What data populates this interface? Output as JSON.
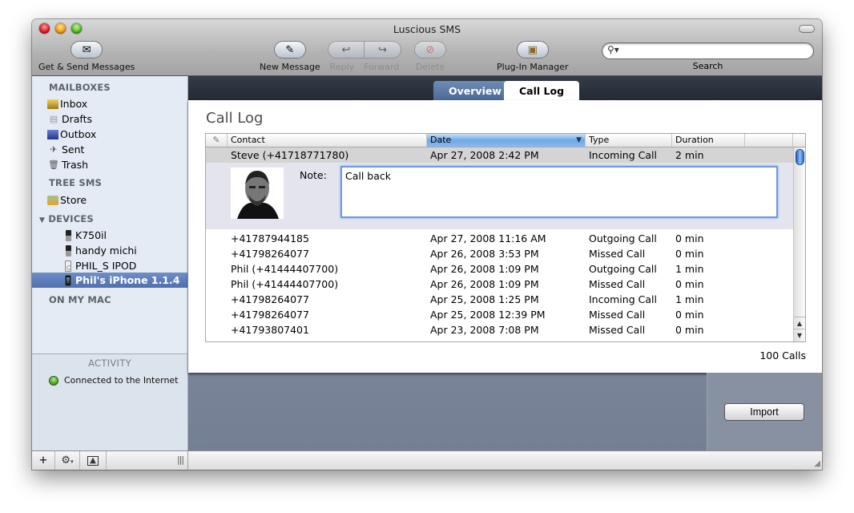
{
  "window": {
    "title": "Luscious SMS"
  },
  "toolbar": {
    "get_send": "Get & Send Messages",
    "new_message": "New Message",
    "reply": "Reply",
    "forward": "Forward",
    "delete": "Delete",
    "plugin_manager": "Plug-In Manager",
    "search_label": "Search",
    "search_placeholder": ""
  },
  "sidebar": {
    "mailboxes_header": "MAILBOXES",
    "mailboxes": [
      {
        "label": "Inbox",
        "icon": "inbox-icon"
      },
      {
        "label": "Drafts",
        "icon": "drafts-icon"
      },
      {
        "label": "Outbox",
        "icon": "outbox-icon"
      },
      {
        "label": "Sent",
        "icon": "sent-icon"
      },
      {
        "label": "Trash",
        "icon": "trash-icon"
      }
    ],
    "tree_header": "TREE SMS",
    "store": "Store",
    "devices_header": "DEVICES",
    "devices": [
      {
        "label": "K750il",
        "icon": "phone-icon"
      },
      {
        "label": "handy michi",
        "icon": "phone-icon"
      },
      {
        "label": "PHIL_S IPOD",
        "icon": "ipod-icon"
      },
      {
        "label": "Phil's iPhone 1.1.4",
        "icon": "iphone-icon",
        "selected": true
      }
    ],
    "on_my_mac_header": "ON MY MAC",
    "activity_title": "ACTIVITY",
    "activity_status": "Connected to the Internet",
    "activity_color": "#3ba416"
  },
  "tabs": {
    "overview": "Overview",
    "call_log": "Call Log",
    "active": "Call Log"
  },
  "panel": {
    "title": "Call Log",
    "columns": {
      "edit": "✎",
      "contact": "Contact",
      "date": "Date",
      "type": "Type",
      "duration": "Duration"
    },
    "selected_row": {
      "contact": "Steve (+41718771780)",
      "date": "Apr 27, 2008 2:42 PM",
      "type": "Incoming Call",
      "duration": "2 min"
    },
    "note_label": "Note:",
    "note_value": "Call back",
    "rows": [
      {
        "contact": "+41787944185",
        "date": "Apr 27, 2008 11:16 AM",
        "type": "Outgoing Call",
        "duration": "0 min"
      },
      {
        "contact": "+41798264077",
        "date": "Apr 26, 2008 3:53 PM",
        "type": "Missed Call",
        "duration": "0 min"
      },
      {
        "contact": "Phil (+41444407700)",
        "date": "Apr 26, 2008 1:09 PM",
        "type": "Outgoing Call",
        "duration": "1 min"
      },
      {
        "contact": "Phil (+41444407700)",
        "date": "Apr 26, 2008 1:09 PM",
        "type": "Missed Call",
        "duration": "0 min"
      },
      {
        "contact": "+41798264077",
        "date": "Apr 25, 2008 1:25 PM",
        "type": "Incoming Call",
        "duration": "1 min"
      },
      {
        "contact": "+41798264077",
        "date": "Apr 25, 2008 12:39 PM",
        "type": "Missed Call",
        "duration": "0 min"
      },
      {
        "contact": "+41793807401",
        "date": "Apr 23, 2008 7:08 PM",
        "type": "Missed Call",
        "duration": "0 min"
      }
    ],
    "call_count": "100 Calls",
    "import_label": "Import"
  }
}
